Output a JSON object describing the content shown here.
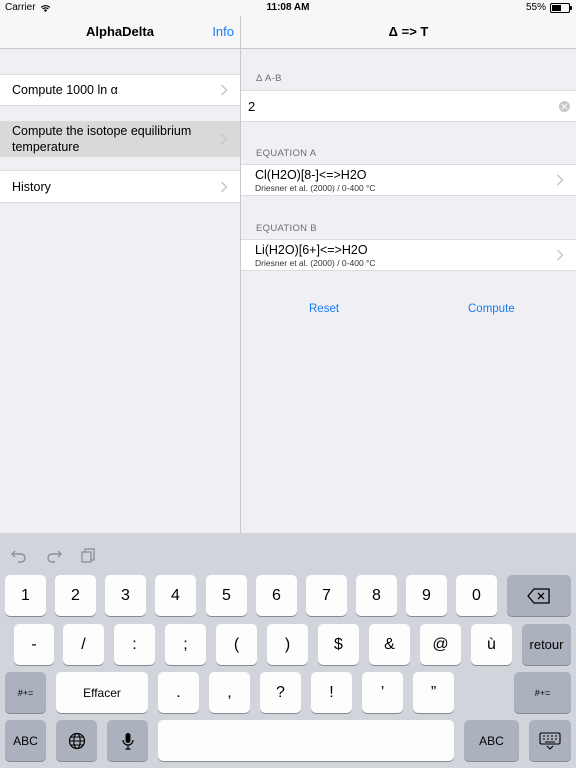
{
  "status_bar": {
    "carrier": "Carrier",
    "time": "11:08 AM",
    "battery": "55%",
    "battery_level": 0.55
  },
  "master": {
    "title": "AlphaDelta",
    "info_label": "Info",
    "items": [
      {
        "label": "Compute 1000 ln α"
      },
      {
        "label": "Compute the isotope equilibrium temperature"
      },
      {
        "label": "History"
      }
    ]
  },
  "detail": {
    "title": "Δ => T",
    "delta_header": "Δ A-B",
    "delta_value": "2",
    "equation_a_header": "EQUATION A",
    "equation_a": {
      "main": "Cl(H2O)[8-]<=>H2O",
      "sub": "Driesner et al. (2000) / 0-400 °C"
    },
    "equation_b_header": "EQUATION B",
    "equation_b": {
      "main": "Li(H2O)[6+]<=>H2O",
      "sub": "Driesner et al. (2000) / 0-400 °C"
    },
    "reset_label": "Reset",
    "compute_label": "Compute"
  },
  "keyboard": {
    "row1": [
      "1",
      "2",
      "3",
      "4",
      "5",
      "6",
      "7",
      "8",
      "9",
      "0"
    ],
    "row2": [
      "-",
      "/",
      ":",
      ";",
      "(",
      ")",
      "$",
      "&",
      "@",
      "ù"
    ],
    "return_label": "retour",
    "row3_left": "#+=",
    "effacer": "Effacer",
    "row3": [
      ".",
      ",",
      "?",
      "!",
      "’",
      "”"
    ],
    "row3_right": "#+=",
    "abc": "ABC"
  },
  "colors": {
    "accent": "#1a7cf5",
    "background": "#efeff4",
    "keyboard": "#d1d5db"
  }
}
